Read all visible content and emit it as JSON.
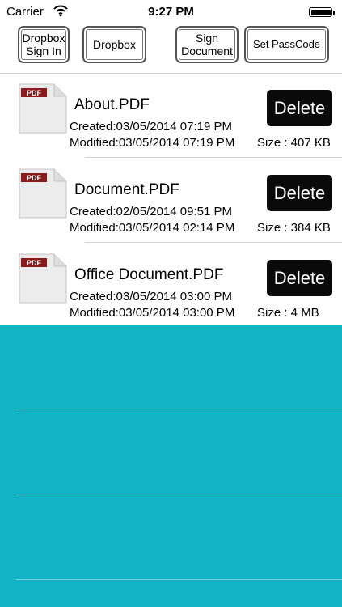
{
  "status_bar": {
    "carrier": "Carrier",
    "time": "9:27 PM"
  },
  "toolbar": {
    "dropbox_sign_in_line1": "Dropbox",
    "dropbox_sign_in_line2": "Sign In",
    "dropbox": "Dropbox",
    "sign_document_line1": "Sign",
    "sign_document_line2": "Document",
    "set_passcode": "Set PassCode"
  },
  "files": [
    {
      "name": "About.PDF",
      "created": "Created:03/05/2014 07:19 PM",
      "modified": "Modified:03/05/2014 07:19 PM",
      "size": "Size : 407 KB",
      "delete_label": "Delete"
    },
    {
      "name": "Document.PDF",
      "created": "Created:02/05/2014 09:51 PM",
      "modified": "Modified:03/05/2014 02:14 PM",
      "size": "Size : 384 KB",
      "delete_label": "Delete"
    },
    {
      "name": "Office Document.PDF",
      "created": "Created:03/05/2014 03:00 PM",
      "modified": "Modified:03/05/2014 03:00 PM",
      "size": "Size : 4 MB",
      "delete_label": "Delete"
    }
  ],
  "icons": {
    "pdf_icon_label": "PDF",
    "pdf_icon": "pdf-file-icon",
    "wifi_icon": "wifi-icon",
    "battery_icon": "battery-icon"
  },
  "colors": {
    "teal_background": "#12b3c3",
    "delete_button": "#0a0a0a",
    "pdf_banner": "#8b1a1a"
  }
}
